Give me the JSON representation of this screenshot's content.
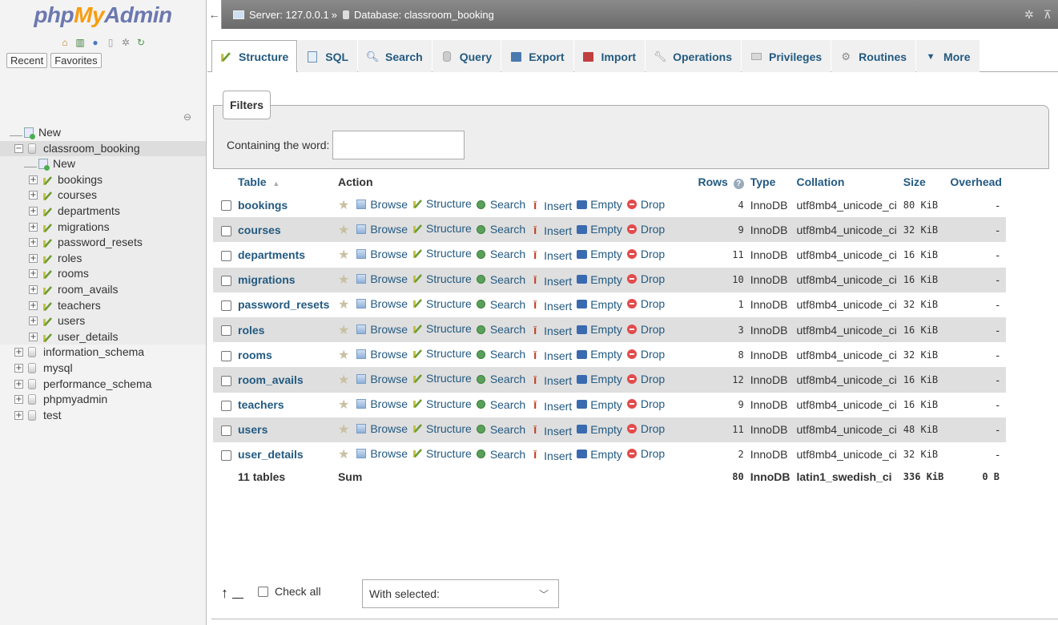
{
  "logo": {
    "php": "php",
    "my": "My",
    "admin": "Admin"
  },
  "nav": {
    "icons": [
      "home-icon",
      "settings-icon",
      "info-icon",
      "docs-icon",
      "gear-icon",
      "reload-icon"
    ],
    "recent_label": "Recent",
    "favorites_label": "Favorites",
    "tree": [
      {
        "label": "New",
        "kind": "new",
        "level": 0
      },
      {
        "label": "classroom_booking",
        "kind": "db",
        "level": 0,
        "expanded": true
      },
      {
        "label": "New",
        "kind": "new",
        "level": 1
      },
      {
        "label": "bookings",
        "kind": "table",
        "level": 1
      },
      {
        "label": "courses",
        "kind": "table",
        "level": 1
      },
      {
        "label": "departments",
        "kind": "table",
        "level": 1
      },
      {
        "label": "migrations",
        "kind": "table",
        "level": 1
      },
      {
        "label": "password_resets",
        "kind": "table",
        "level": 1
      },
      {
        "label": "roles",
        "kind": "table",
        "level": 1
      },
      {
        "label": "rooms",
        "kind": "table",
        "level": 1
      },
      {
        "label": "room_avails",
        "kind": "table",
        "level": 1
      },
      {
        "label": "teachers",
        "kind": "table",
        "level": 1
      },
      {
        "label": "users",
        "kind": "table",
        "level": 1
      },
      {
        "label": "user_details",
        "kind": "table",
        "level": 1
      },
      {
        "label": "information_schema",
        "kind": "db",
        "level": 0
      },
      {
        "label": "mysql",
        "kind": "db",
        "level": 0
      },
      {
        "label": "performance_schema",
        "kind": "db",
        "level": 0
      },
      {
        "label": "phpmyadmin",
        "kind": "db",
        "level": 0
      },
      {
        "label": "test",
        "kind": "db",
        "level": 0
      }
    ]
  },
  "breadcrumb": {
    "server": "Server: 127.0.0.1",
    "sep": "»",
    "database": "Database: classroom_booking"
  },
  "tabs": [
    {
      "label": "Structure",
      "icon": "structure-icon",
      "active": true
    },
    {
      "label": "SQL",
      "icon": "sql-icon"
    },
    {
      "label": "Search",
      "icon": "search-icon"
    },
    {
      "label": "Query",
      "icon": "query-icon"
    },
    {
      "label": "Export",
      "icon": "export-icon"
    },
    {
      "label": "Import",
      "icon": "import-icon"
    },
    {
      "label": "Operations",
      "icon": "wrench-icon"
    },
    {
      "label": "Privileges",
      "icon": "privileges-icon"
    },
    {
      "label": "Routines",
      "icon": "routines-icon"
    },
    {
      "label": "More",
      "icon": "caret-down-icon"
    }
  ],
  "filters": {
    "legend": "Filters",
    "label": "Containing the word:",
    "value": ""
  },
  "table": {
    "headers": {
      "table": "Table",
      "sort": "▲",
      "action": "Action",
      "rows": "Rows",
      "type": "Type",
      "collation": "Collation",
      "size": "Size",
      "overhead": "Overhead"
    },
    "actions": [
      "Browse",
      "Structure",
      "Search",
      "Insert",
      "Empty",
      "Drop"
    ],
    "rows": [
      {
        "name": "bookings",
        "rows": "4",
        "type": "InnoDB",
        "collation": "utf8mb4_unicode_ci",
        "size": "80 KiB",
        "overhead": "-"
      },
      {
        "name": "courses",
        "rows": "9",
        "type": "InnoDB",
        "collation": "utf8mb4_unicode_ci",
        "size": "32 KiB",
        "overhead": "-"
      },
      {
        "name": "departments",
        "rows": "11",
        "type": "InnoDB",
        "collation": "utf8mb4_unicode_ci",
        "size": "16 KiB",
        "overhead": "-"
      },
      {
        "name": "migrations",
        "rows": "10",
        "type": "InnoDB",
        "collation": "utf8mb4_unicode_ci",
        "size": "16 KiB",
        "overhead": "-"
      },
      {
        "name": "password_resets",
        "rows": "1",
        "type": "InnoDB",
        "collation": "utf8mb4_unicode_ci",
        "size": "32 KiB",
        "overhead": "-"
      },
      {
        "name": "roles",
        "rows": "3",
        "type": "InnoDB",
        "collation": "utf8mb4_unicode_ci",
        "size": "16 KiB",
        "overhead": "-"
      },
      {
        "name": "rooms",
        "rows": "8",
        "type": "InnoDB",
        "collation": "utf8mb4_unicode_ci",
        "size": "32 KiB",
        "overhead": "-"
      },
      {
        "name": "room_avails",
        "rows": "12",
        "type": "InnoDB",
        "collation": "utf8mb4_unicode_ci",
        "size": "16 KiB",
        "overhead": "-"
      },
      {
        "name": "teachers",
        "rows": "9",
        "type": "InnoDB",
        "collation": "utf8mb4_unicode_ci",
        "size": "16 KiB",
        "overhead": "-"
      },
      {
        "name": "users",
        "rows": "11",
        "type": "InnoDB",
        "collation": "utf8mb4_unicode_ci",
        "size": "48 KiB",
        "overhead": "-"
      },
      {
        "name": "user_details",
        "rows": "2",
        "type": "InnoDB",
        "collation": "utf8mb4_unicode_ci",
        "size": "32 KiB",
        "overhead": "-"
      }
    ],
    "summary": {
      "tables": "11 tables",
      "sum": "Sum",
      "rows": "80",
      "type": "InnoDB",
      "collation": "latin1_swedish_ci",
      "size": "336 KiB",
      "overhead": "0 B"
    }
  },
  "footer": {
    "check_all": "Check all",
    "with_selected": "With selected:"
  },
  "colors": {
    "link": "#235a81",
    "even_row": "#dfdfdf",
    "topbar": "#7a7a7a",
    "drop_red": "#e24b4b"
  }
}
